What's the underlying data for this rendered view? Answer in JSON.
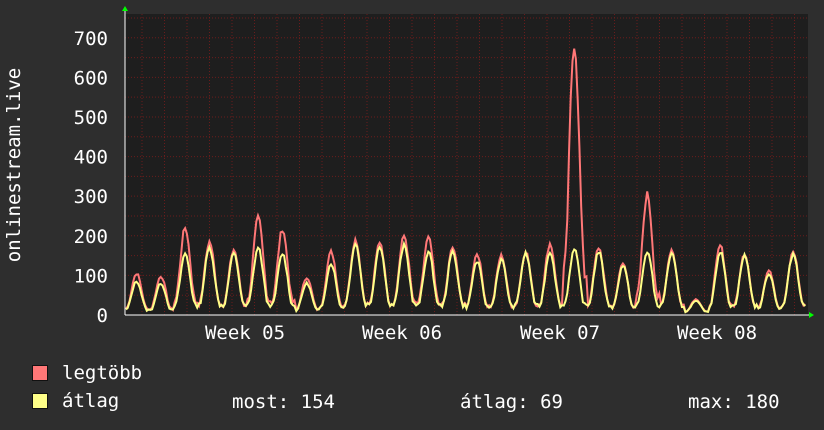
{
  "chart_data": {
    "type": "line",
    "ylabel": "onlinestream.live",
    "yticks": [
      0,
      100,
      200,
      300,
      400,
      500,
      600,
      700
    ],
    "ylim": [
      0,
      760
    ],
    "x_ticks": [
      "Week 05",
      "Week 06",
      "Week 07",
      "Week 08"
    ],
    "grid": true,
    "series": [
      {
        "name": "legtöbb",
        "color": "#ff7777",
        "approx_peaks": [
          105,
          98,
          220,
          185,
          165,
          245,
          217,
          95,
          160,
          190,
          185,
          200,
          195,
          170,
          155,
          150,
          160,
          180,
          690,
          170,
          130,
          305,
          165,
          40,
          175,
          155,
          115,
          160
        ]
      },
      {
        "name": "átlag",
        "color": "#ffff88",
        "approx_peaks": [
          85,
          80,
          155,
          170,
          155,
          170,
          155,
          80,
          130,
          180,
          175,
          175,
          160,
          160,
          135,
          140,
          155,
          160,
          165,
          160,
          125,
          160,
          155,
          35,
          160,
          150,
          105,
          155
        ]
      }
    ]
  },
  "legend": {
    "max_label": "legtöbb",
    "avg_label": "átlag",
    "current": "most: 154",
    "average": "átlag: 69",
    "maximum": "max: 180"
  },
  "colors": {
    "background": "#2e2e2e",
    "plot_bg": "#1e1e1e",
    "max_series": "#ff7777",
    "avg_series": "#ffff88",
    "grid": "#6a1c1c",
    "arrow": "#00ff00"
  }
}
